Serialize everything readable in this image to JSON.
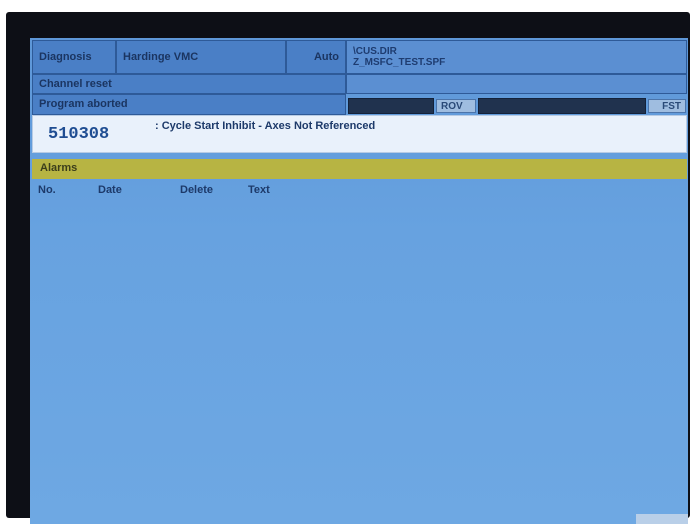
{
  "header": {
    "mode_group": "Diagnosis",
    "machine": "Hardinge VMC",
    "mode": "Auto",
    "program_path_line1": "\\CUS.DIR",
    "program_path_line2": "Z_MSFC_TEST.SPF",
    "channel_status": "Channel reset",
    "program_status": "Program aborted",
    "rov_label": "ROV",
    "right_indicator": "FST"
  },
  "alarm_line": {
    "number": "510308",
    "message": ": Cycle Start Inhibit - Axes Not Referenced"
  },
  "alarms_panel": {
    "title": "Alarms",
    "columns": [
      "No.",
      "Date",
      "Delete",
      "Text"
    ]
  }
}
